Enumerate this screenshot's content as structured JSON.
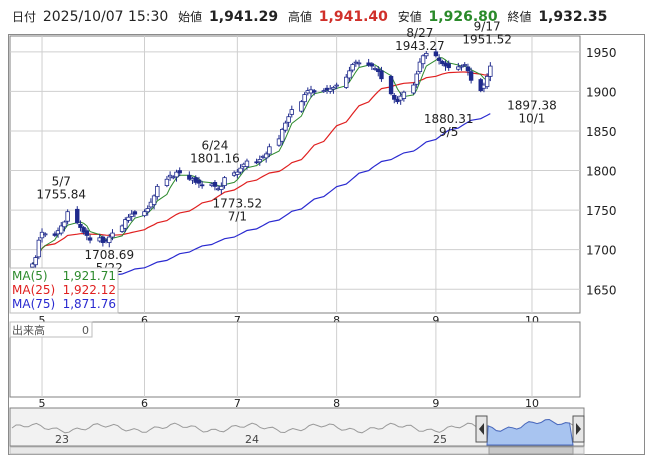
{
  "header": {
    "label_date": "日付",
    "datetime": "2025/10/07 15:30",
    "label_open": "始値",
    "open": "1,941.29",
    "label_high": "高値",
    "high": "1,941.40",
    "label_low": "安値",
    "low": "1,926.80",
    "label_close": "終値",
    "close": "1,932.35"
  },
  "legend": {
    "ma5_label": "MA(5)",
    "ma5_value": "1,921.71",
    "ma25_label": "MA(25)",
    "ma25_value": "1,922.12",
    "ma75_label": "MA(75)",
    "ma75_value": "1,871.76"
  },
  "volume": {
    "label": "出来高",
    "value": "0"
  },
  "colors": {
    "up": "#ffffff",
    "down": "#1f2a8c",
    "ma5": "#2e8b2e",
    "ma25": "#e02020",
    "ma75": "#2a2ad0",
    "grid": "#cfcfcf",
    "frame": "#808080",
    "navigator_fill": "#a8c4f0"
  },
  "chart_data": {
    "type": "candlestick",
    "ylim": [
      1620,
      1970
    ],
    "yticks": [
      1650,
      1700,
      1750,
      1800,
      1850,
      1900,
      1950
    ],
    "month_labels": [
      {
        "label": "5",
        "date": "2025-05-01"
      },
      {
        "label": "6",
        "date": "2025-06-02"
      },
      {
        "label": "7",
        "date": "2025-07-01"
      },
      {
        "label": "8",
        "date": "2025-08-01"
      },
      {
        "label": "9",
        "date": "2025-09-01"
      },
      {
        "label": "10",
        "date": "2025-10-01"
      }
    ],
    "annotations": [
      {
        "date": "5/7",
        "value": "1755.84",
        "kind": "high"
      },
      {
        "date": "5/22",
        "value": "1708.69",
        "kind": "low"
      },
      {
        "date": "6/24",
        "value": "1801.16",
        "kind": "high"
      },
      {
        "date": "7/1",
        "value": "1773.52",
        "kind": "low"
      },
      {
        "date": "8/27",
        "value": "1943.27",
        "kind": "high"
      },
      {
        "date": "9/5",
        "value": "1880.31",
        "kind": "low"
      },
      {
        "date": "9/17",
        "value": "1951.52",
        "kind": "high"
      },
      {
        "date": "10/1",
        "value": "1897.38",
        "kind": "low"
      }
    ],
    "close_series": [
      1682,
      1690,
      1712,
      1722,
      1720,
      1718,
      1724,
      1730,
      1735,
      1748,
      1734,
      1728,
      1722,
      1718,
      1712,
      1715,
      1709,
      1711,
      1716,
      1721,
      1730,
      1738,
      1741,
      1745,
      1745,
      1748,
      1752,
      1760,
      1768,
      1780,
      1789,
      1794,
      1792,
      1798,
      1797,
      1789,
      1790,
      1785,
      1784,
      1781,
      1783,
      1780,
      1777,
      1780,
      1791,
      1797,
      1798,
      1803,
      1808,
      1812,
      1810,
      1814,
      1818,
      1821,
      1830,
      1840,
      1852,
      1860,
      1868,
      1877,
      1887,
      1896,
      1901,
      1902,
      1899,
      1901,
      1902,
      1903,
      1905,
      1908,
      1918,
      1926,
      1934,
      1937,
      1936,
      1933,
      1932,
      1929,
      1925,
      1916,
      1897,
      1890,
      1887,
      1894,
      1899,
      1908,
      1922,
      1937,
      1945,
      1948,
      1945,
      1939,
      1935,
      1932,
      1930,
      1931,
      1932,
      1934,
      1926,
      1914,
      1901,
      1908,
      1919,
      1932
    ],
    "navigator": {
      "labels": [
        "23",
        "24",
        "25"
      ]
    }
  }
}
